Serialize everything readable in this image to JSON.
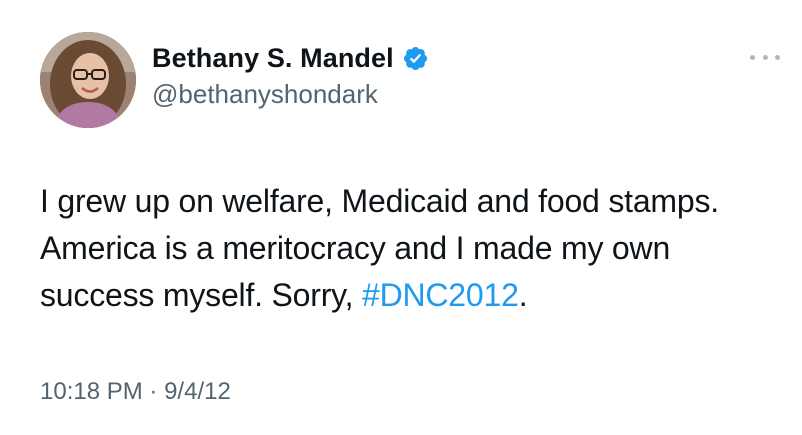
{
  "tweet": {
    "author": {
      "display_name": "Bethany S. Mandel",
      "handle": "@bethanyshondark",
      "verified_icon": "verified-badge-icon",
      "avatar_icon": "profile-photo"
    },
    "more_icon": "more-options-icon",
    "text_before": "I grew up on welfare, Medicaid and food stamps. America is a meritocracy and I made my own success myself. Sorry, ",
    "hashtag": "#DNC2012",
    "text_after": ".",
    "time": "10:18 PM",
    "separator": "·",
    "date": "9/4/12"
  },
  "colors": {
    "text": "#0f1419",
    "secondary": "#536471",
    "accent": "#1d9bf0"
  }
}
